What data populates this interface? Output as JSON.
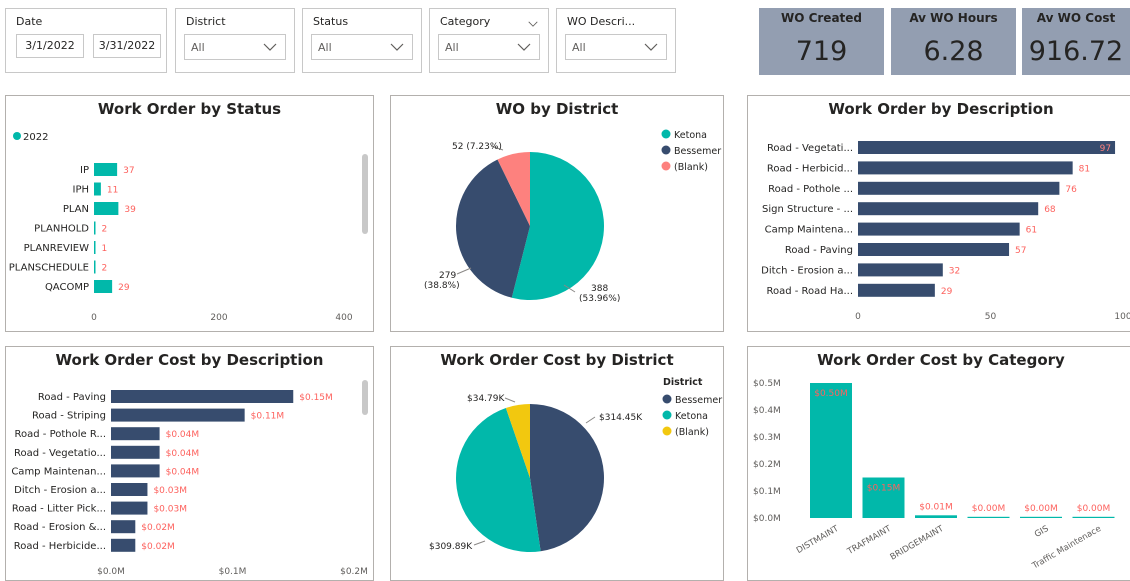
{
  "slicers": {
    "date": {
      "label": "Date",
      "from": "3/1/2022",
      "to": "3/31/2022"
    },
    "district": {
      "label": "District",
      "value": "All"
    },
    "status": {
      "label": "Status",
      "value": "All"
    },
    "category": {
      "label": "Category",
      "value": "All"
    },
    "wo_desc": {
      "label": "WO Descri...",
      "value": "All"
    }
  },
  "kpis": [
    {
      "title": "WO Created",
      "value": "719"
    },
    {
      "title": "Av WO Hours",
      "value": "6.28"
    },
    {
      "title": "Av WO Cost",
      "value": "916.72"
    }
  ],
  "colors": {
    "teal": "#01b8aa",
    "navy": "#374c6e",
    "salmon": "#fd817e",
    "yellow": "#f2c80f",
    "kpi_bg": "#939eb1",
    "label_red": "#fd625e"
  },
  "chart_data": [
    {
      "type": "bar",
      "title": "Work Order by Status",
      "legend": [
        "2022"
      ],
      "categories": [
        "IP",
        "IPH",
        "PLAN",
        "PLANHOLD",
        "PLANREVIEW",
        "PLANSCHEDULE",
        "QACOMP"
      ],
      "values": [
        37,
        11,
        39,
        2,
        1,
        2,
        29
      ],
      "data_labels": [
        "37",
        "11",
        "39",
        "2",
        "1",
        "2",
        "29"
      ],
      "xticks": [
        "0",
        "200",
        "400"
      ],
      "xlim": [
        0,
        430
      ]
    },
    {
      "type": "pie",
      "title": "WO by District",
      "legend": [
        "Ketona",
        "Bessemer",
        "(Blank)"
      ],
      "values": [
        388,
        279,
        52
      ],
      "data_labels": [
        "388\n(53.96%)",
        "279\n(38.8%)",
        "52 (7.23%)"
      ]
    },
    {
      "type": "bar",
      "title": "Work Order by Description",
      "categories": [
        "Road - Vegetati...",
        "Road - Herbicid...",
        "Road - Pothole ...",
        "Sign Structure - ...",
        "Camp Maintena...",
        "Road - Paving",
        "Ditch - Erosion a...",
        "Road - Road Ha..."
      ],
      "values": [
        97,
        81,
        76,
        68,
        61,
        57,
        32,
        29
      ],
      "data_labels": [
        "97",
        "81",
        "76",
        "68",
        "61",
        "57",
        "32",
        "29"
      ],
      "xticks": [
        "0",
        "50",
        "100"
      ],
      "xlim": [
        0,
        100
      ]
    },
    {
      "type": "bar",
      "title": "Work Order Cost by Description",
      "categories": [
        "Road - Paving",
        "Road - Striping",
        "Road - Pothole R...",
        "Road - Vegetatio...",
        "Camp Maintenan...",
        "Ditch - Erosion a...",
        "Road - Litter Pick...",
        "Road - Erosion &...",
        "Road - Herbicide..."
      ],
      "values": [
        0.15,
        0.11,
        0.04,
        0.04,
        0.04,
        0.03,
        0.03,
        0.02,
        0.02
      ],
      "data_labels": [
        "$0.15M",
        "$0.11M",
        "$0.04M",
        "$0.04M",
        "$0.04M",
        "$0.03M",
        "$0.03M",
        "$0.02M",
        "$0.02M"
      ],
      "xticks": [
        "$0.0M",
        "$0.1M",
        "$0.2M"
      ],
      "xlim": [
        0,
        0.21
      ]
    },
    {
      "type": "pie",
      "title": "Work Order Cost by District",
      "legend_title": "District",
      "legend": [
        "Bessemer",
        "Ketona",
        "(Blank)"
      ],
      "values": [
        314.45,
        309.89,
        34.79
      ],
      "data_labels": [
        "$314.45K",
        "$309.89K",
        "$34.79K"
      ]
    },
    {
      "type": "bar",
      "title": "Work Order Cost by Category",
      "categories": [
        "DISTMAINT",
        "TRAFMAINT",
        "BRIDGEMAINT",
        "",
        "GIS",
        "Traffic Maintenace"
      ],
      "values": [
        0.5,
        0.15,
        0.01,
        0.004,
        0.001,
        0.0005
      ],
      "data_labels": [
        "$0.50M",
        "$0.15M",
        "$0.01M",
        "$0.00M",
        "$0.00M",
        "$0.00M"
      ],
      "yticks": [
        "$0.0M",
        "$0.1M",
        "$0.2M",
        "$0.3M",
        "$0.4M",
        "$0.5M"
      ],
      "ylim": [
        0,
        0.5
      ]
    }
  ]
}
